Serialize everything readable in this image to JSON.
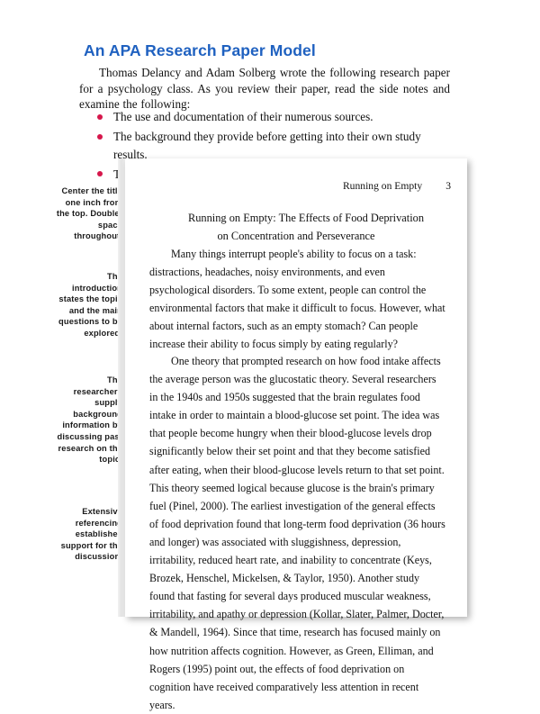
{
  "intro": {
    "title": "An APA Research Paper Model",
    "paragraph": "Thomas Delancy and Adam Solberg wrote the following research paper for a psychology class. As you review their paper, read the side notes and examine the following:",
    "bullets": [
      "The use and documentation of their numerous sources.",
      "The background they provide before getting into their own study results.",
      "The scientific language used when reporting their results."
    ]
  },
  "document": {
    "running_head": "Running on Empty",
    "page_number": "3",
    "title_line_1": "Running on Empty: The Effects of Food Deprivation",
    "title_line_2": "on Concentration and Perseverance",
    "paragraph_1": "Many things interrupt people's ability to focus on a task: distractions, headaches, noisy environments, and even psychological disorders.  To some extent, people can control the environmental factors that make it difficult to focus.  However, what about internal factors, such as an empty stomach?  Can people increase their ability to focus simply by eating regularly?",
    "paragraph_2": "One theory that prompted research on how food intake affects the average person was the glucostatic theory.  Several researchers in the 1940s and 1950s suggested that the brain regulates food intake in order to maintain a blood-glucose set point.  The idea was that people become hungry when their blood-glucose levels drop significantly below their set point and that they become satisfied after eating, when their blood-glucose levels return to that set point.  This theory seemed logical because glucose is the brain's primary fuel (Pinel, 2000).  The earliest investigation of the general effects of food deprivation found that long-term food deprivation (36 hours and longer) was associated with sluggishness, depression, irritability, reduced heart rate, and inability to concentrate (Keys, Brozek, Henschel, Mickelsen, & Taylor, 1950).  Another study found that fasting for several days produced muscular weakness, irritability, and apathy or depression (Kollar, Slater, Palmer, Docter, & Mandell, 1964).  Since that time, research has focused mainly on how nutrition affects cognition.  However, as Green, Elliman, and Rogers (1995) point out, the effects of food deprivation on cognition have received comparatively less attention in recent years."
  },
  "side_notes": [
    {
      "text": "Center the title one inch from the top. Double-space throughout."
    },
    {
      "text": "The introduction states the topic and the main questions to be explored."
    },
    {
      "text": "The researchers supply background information by discussing past research on the topic."
    },
    {
      "text": "Extensive referencing establishes support for the discussion."
    }
  ],
  "colors": {
    "title_blue": "#1f61c0",
    "bullet_red": "#d6174b",
    "bracket_teal": "#8fd8d8",
    "body_text": "#111111"
  }
}
